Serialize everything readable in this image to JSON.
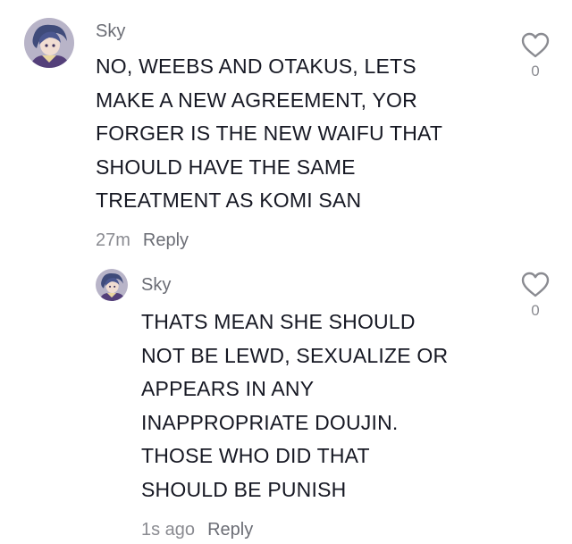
{
  "comment": {
    "username": "Sky",
    "lines": [
      "NO, WEEBS AND OTAKUS, LETS",
      "MAKE A NEW AGREEMENT, YOR",
      "FORGER IS THE NEW WAIFU THAT",
      "SHOULD HAVE THE SAME",
      "TREATMENT AS KOMI SAN"
    ],
    "time": "27m",
    "reply_label": "Reply",
    "like_count": "0",
    "like_icon": "heart-outline-icon"
  },
  "reply": {
    "username": "Sky",
    "lines": [
      "THATS MEAN SHE SHOULD",
      "NOT BE LEWD, SEXUALIZE OR",
      "APPEARS IN ANY",
      "INAPPROPRIATE DOUJIN.",
      "THOSE WHO DID THAT",
      "SHOULD BE PUNISH"
    ],
    "time": "1s ago",
    "reply_label": "Reply",
    "like_count": "0",
    "like_icon": "heart-outline-icon"
  },
  "colors": {
    "text": "#161823",
    "secondary": "#8a8b91",
    "username": "#6b6d75"
  }
}
